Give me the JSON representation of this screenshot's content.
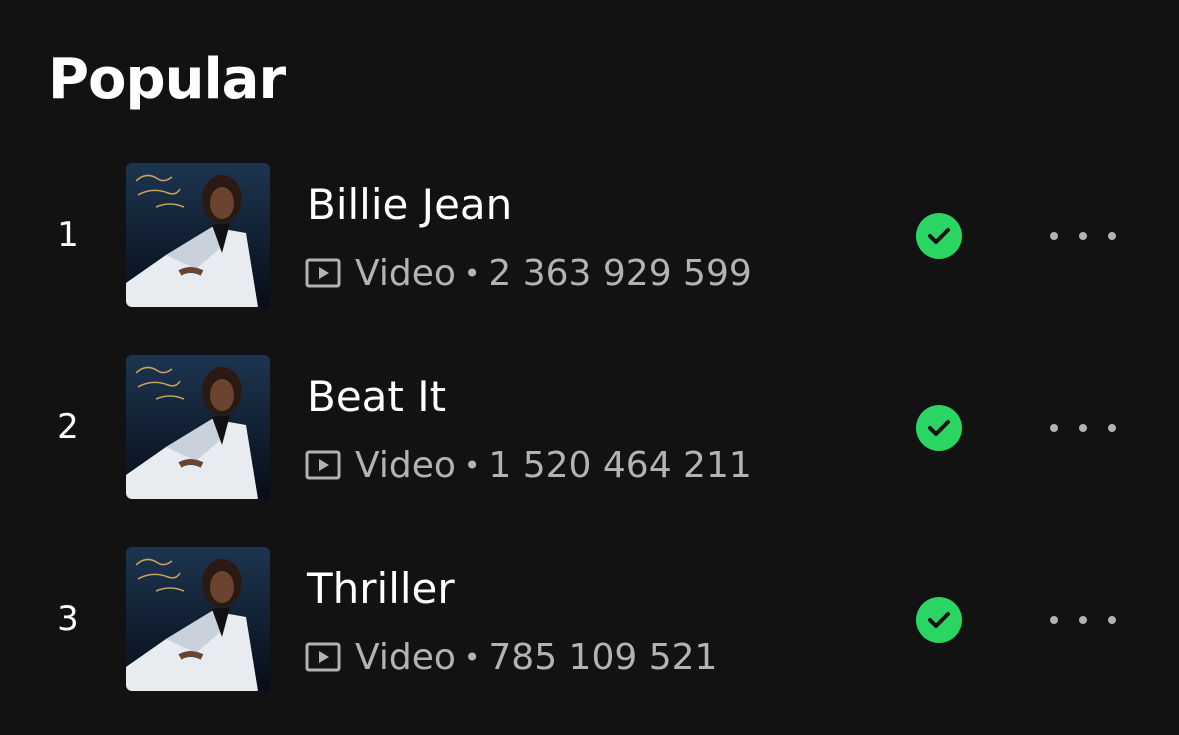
{
  "section": {
    "title": "Popular"
  },
  "tracks": [
    {
      "rank": "1",
      "title": "Billie Jean",
      "type": "Video",
      "separator": "•",
      "plays": "2 363 929 599",
      "saved": true,
      "cover_icon": "album-cover-thriller"
    },
    {
      "rank": "2",
      "title": "Beat It",
      "type": "Video",
      "separator": "•",
      "plays": "1 520 464 211",
      "saved": true,
      "cover_icon": "album-cover-thriller"
    },
    {
      "rank": "3",
      "title": "Thriller",
      "type": "Video",
      "separator": "•",
      "plays": "785 109 521",
      "saved": true,
      "cover_icon": "album-cover-thriller"
    }
  ],
  "colors": {
    "background": "#121212",
    "saved_accent": "#2bd564",
    "secondary_text": "#b3b3b3"
  }
}
